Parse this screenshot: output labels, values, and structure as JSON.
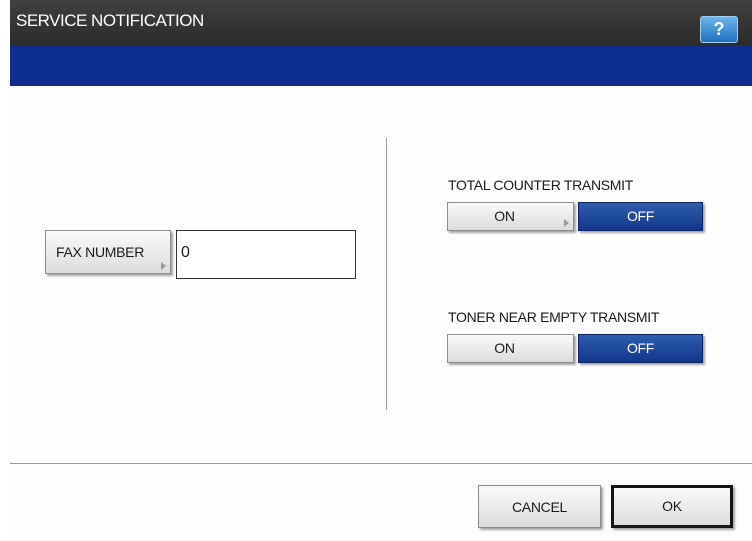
{
  "window": {
    "title": "SERVICE NOTIFICATION",
    "help_label": "?"
  },
  "fax": {
    "button_label": "FAX NUMBER",
    "value": "0"
  },
  "total_counter": {
    "label": "TOTAL COUNTER TRANSMIT",
    "on_label": "ON",
    "off_label": "OFF",
    "selected": "OFF"
  },
  "toner_near_empty": {
    "label": "TONER NEAR EMPTY TRANSMIT",
    "on_label": "ON",
    "off_label": "OFF",
    "selected": "OFF"
  },
  "footer": {
    "cancel_label": "CANCEL",
    "ok_label": "OK"
  },
  "colors": {
    "title_bar": "#333333",
    "header_band": "#0e2d8e",
    "selected_button": "#1a4496",
    "help_button": "#2f86d6"
  },
  "icons": {
    "help": "question-mark-icon",
    "submenu": "corner-arrow-icon"
  }
}
